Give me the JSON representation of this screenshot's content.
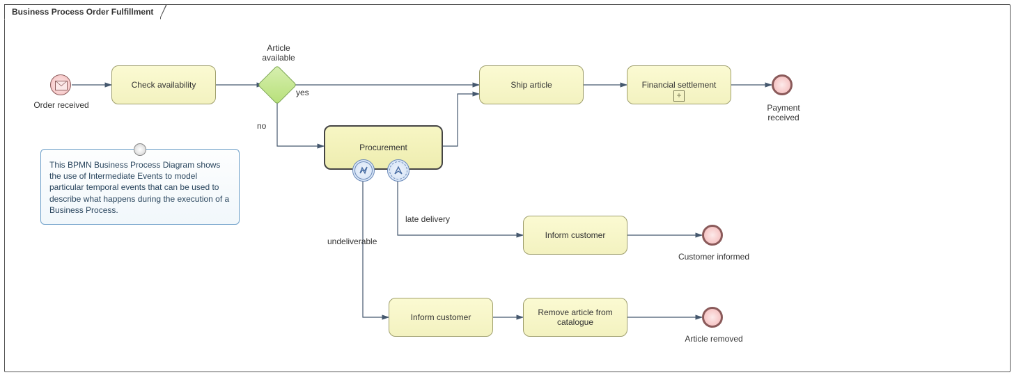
{
  "pool_title": "Business Process Order Fulfillment",
  "events": {
    "start_label": "Order received",
    "end1_label": "Payment\nreceived",
    "end2_label": "Customer informed",
    "end3_label": "Article removed"
  },
  "tasks": {
    "check": "Check availability",
    "ship": "Ship article",
    "fin": "Financial settlement",
    "proc": "Procurement",
    "inform1": "Inform customer",
    "inform2": "Inform customer",
    "remove": "Remove article from catalogue"
  },
  "gateway": {
    "title": "Article\navailable",
    "yes": "yes",
    "no": "no"
  },
  "boundary": {
    "undeliverable": "undeliverable",
    "late": "late delivery"
  },
  "note": "This BPMN Business Process Diagram shows the use of Intermediate Events to model particular temporal events that can be used to describe what happens during the execution of a Business Process.",
  "colors": {
    "task_fill": "#f6f5c7",
    "task_border": "#9e9e6c",
    "event_pink": "#f4b6b6",
    "gateway_green": "#b7e07a",
    "edge": "#45586e"
  }
}
